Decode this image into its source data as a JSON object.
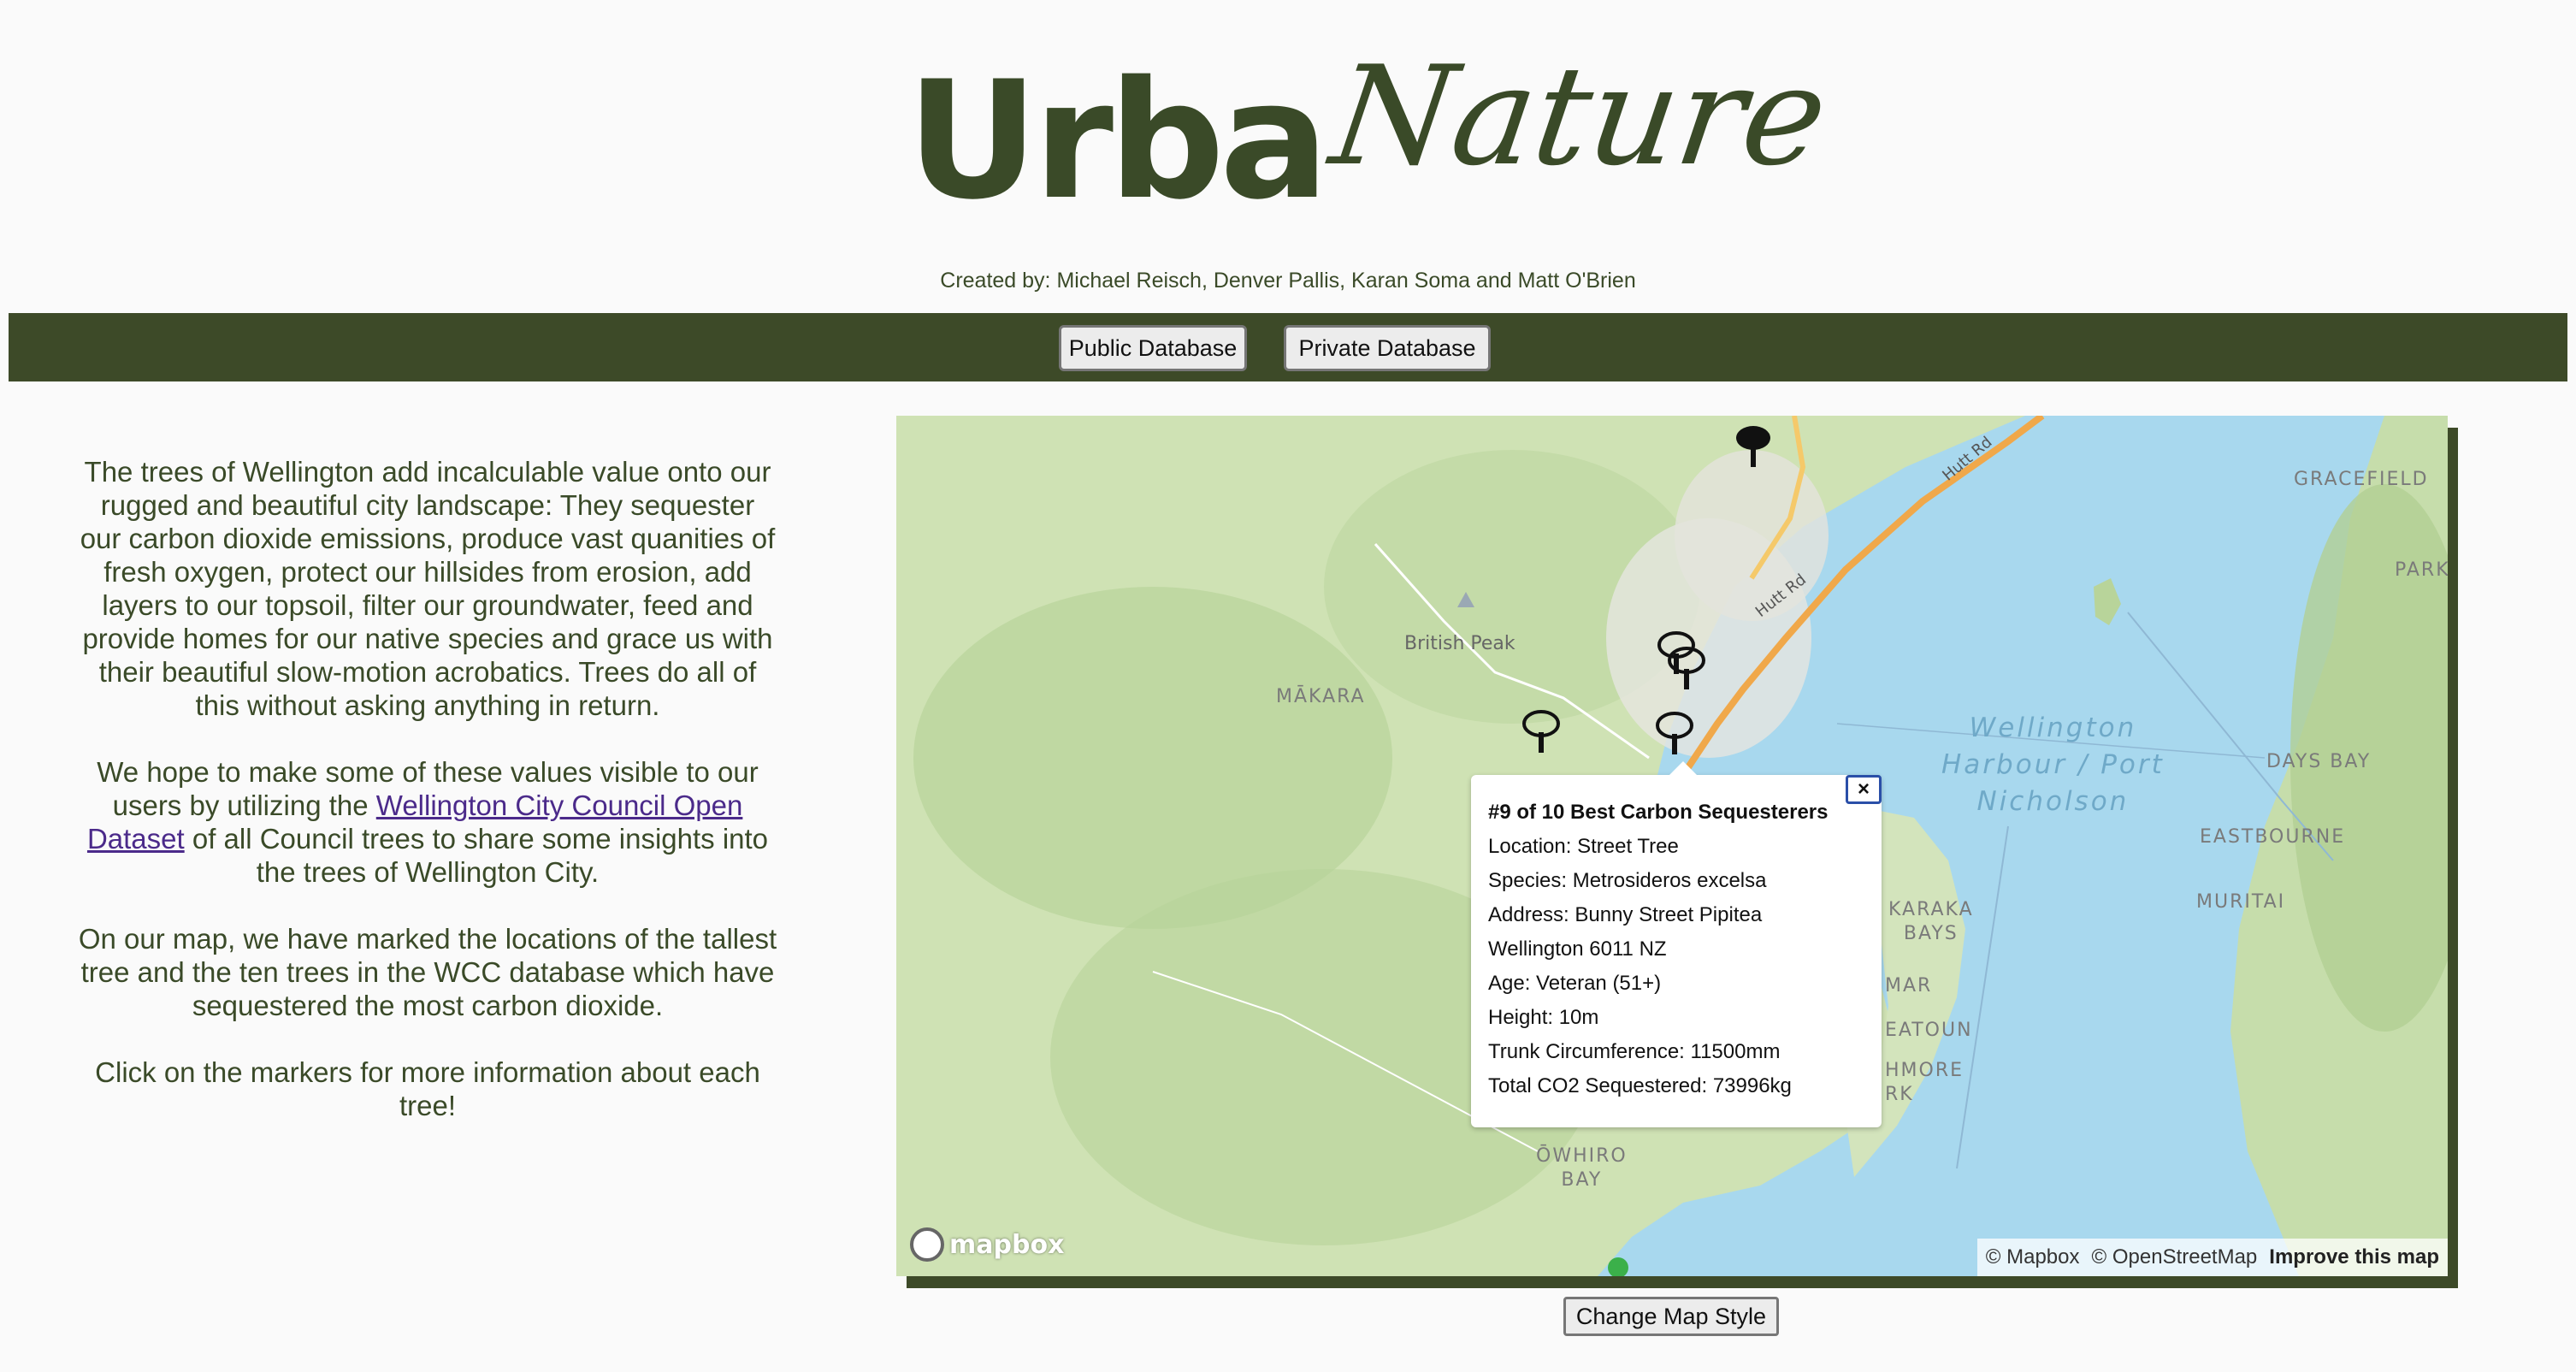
{
  "header": {
    "logo_part1": "Urba",
    "logo_part2": "Nature",
    "credits": "Created by: Michael Reisch, Denver Pallis, Karan Soma and Matt O'Brien"
  },
  "nav": {
    "public_label": "Public Database",
    "private_label": "Private Database"
  },
  "intro": {
    "p1": "The trees of Wellington add incalculable value onto our rugged and beautiful city landscape: They sequester our carbon dioxide emissions, produce vast quanities of fresh oxygen, protect our hillsides from erosion, add layers to our topsoil, filter our groundwater, feed and provide homes for our native species and grace us with their beautiful slow-motion acrobatics. Trees do all of this without asking anything in return.",
    "p2_before": "We hope to make some of these values visible to our users by utilizing the ",
    "p2_link": "Wellington City Council Open Dataset",
    "p2_after": " of all Council trees to share some insights into the trees of Wellington City.",
    "p3": "On our map, we have marked the locations of the tallest tree and the ten trees in the WCC database which have sequestered the most carbon dioxide.",
    "p4": "Click on the markers for more information about each tree!"
  },
  "map": {
    "colors": {
      "land": "#d9e8c8",
      "water": "#a8d8ee",
      "forest": "#b8d49a",
      "road": "#f0a84a",
      "frame": "#3d4a28"
    },
    "place_labels": {
      "gracefield": "GRACEFIELD",
      "park": "PARK",
      "british_peak": "British Peak",
      "makara": "MĀKARA",
      "days_bay": "DAYS BAY",
      "eastbourne": "EASTBOURNE",
      "muritai": "MURITAI",
      "karaka_bays": "KARAKA\nBAYS",
      "mar": "MAR",
      "seatoun": "EATOUN",
      "hmore": "HMORE\nRK",
      "owhiro_bay": "ŌWHIRO\nBAY"
    },
    "water_label_line1": "Wellington",
    "water_label_line2": "Harbour / Port",
    "water_label_line3": "Nicholson",
    "road_labels": {
      "hutt_rd_1": "Hutt Rd",
      "hutt_rd_2": "Hutt Rd"
    },
    "marker_icon": "tree-marker-icon",
    "popup": {
      "title": "#9 of 10 Best Carbon Sequesterers",
      "location": "Location: Street Tree",
      "species": "Species: Metrosideros excelsa",
      "address": "Address: Bunny Street Pipitea",
      "city": "Wellington 6011 NZ",
      "age": "Age: Veteran (51+)",
      "height": "Height: 10m",
      "trunk": "Trunk Circumference: 11500mm",
      "co2": "Total CO2 Sequestered: 73996kg",
      "close_label": "×"
    },
    "mapbox_logo": "mapbox",
    "attribution_mapbox": "© Mapbox",
    "attribution_osm": "© OpenStreetMap",
    "attribution_improve": "Improve this map"
  },
  "map_style_button": "Change Map Style"
}
